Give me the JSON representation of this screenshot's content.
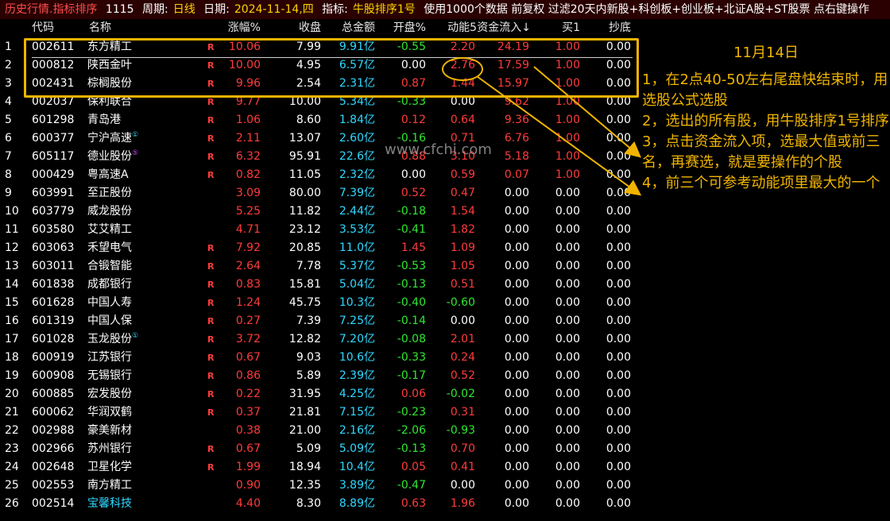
{
  "topbar": {
    "title": "历史行情.指标排序",
    "count": "1115",
    "period_label": "周期:",
    "period_value": "日线",
    "date_label": "日期:",
    "date_value": "2024-11-14,四",
    "indicator_label": "指标:",
    "indicator_value": "牛股排序1号",
    "extra": "使用1000个数据 前复权 过滤20天内新股+科创板+创业板+北证A股+ST股票 点右键操作"
  },
  "columns": {
    "code": "代码",
    "name": "名称",
    "change": "涨幅%",
    "close": "收盘",
    "amount": "总金额",
    "open": "开盘%",
    "momentum": "动能5",
    "inflow": "资金流入↓",
    "buy1": "买1",
    "bottom": "抄底"
  },
  "r_marker": "R",
  "rows": [
    {
      "idx": "1",
      "code": "002611",
      "name": "东方精工",
      "sup": "",
      "r": "R",
      "change": "10.06",
      "close": "7.99",
      "amount": "9.91亿",
      "open": "-0.55",
      "momentum": "2.20",
      "inflow": "24.19",
      "buy1": "1.00",
      "bottom": "0.00"
    },
    {
      "idx": "2",
      "code": "000812",
      "name": "陕西金叶",
      "sup": "",
      "r": "R",
      "change": "10.00",
      "close": "4.95",
      "amount": "6.57亿",
      "open": "0.00",
      "momentum": "2.76",
      "inflow": "17.59",
      "buy1": "1.00",
      "bottom": "0.00"
    },
    {
      "idx": "3",
      "code": "002431",
      "name": "棕榈股份",
      "sup": "",
      "r": "R",
      "change": "9.96",
      "close": "2.54",
      "amount": "2.31亿",
      "open": "0.87",
      "momentum": "1.44",
      "inflow": "15.97",
      "buy1": "1.00",
      "bottom": "0.00"
    },
    {
      "idx": "4",
      "code": "002037",
      "name": "保利联合",
      "sup": "",
      "r": "R",
      "change": "9.77",
      "close": "10.00",
      "amount": "5.34亿",
      "open": "-0.33",
      "momentum": "0.00",
      "inflow": "9.62",
      "buy1": "1.00",
      "bottom": "0.00"
    },
    {
      "idx": "5",
      "code": "601298",
      "name": "青岛港",
      "sup": "",
      "r": "R",
      "change": "1.06",
      "close": "8.60",
      "amount": "1.84亿",
      "open": "0.12",
      "momentum": "0.64",
      "inflow": "9.36",
      "buy1": "1.00",
      "bottom": "0.00"
    },
    {
      "idx": "6",
      "code": "600377",
      "name": "宁沪高速",
      "sup": "①",
      "r": "R",
      "change": "2.11",
      "close": "13.07",
      "amount": "2.60亿",
      "open": "-0.16",
      "momentum": "0.71",
      "inflow": "6.76",
      "buy1": "1.00",
      "bottom": "0.00"
    },
    {
      "idx": "7",
      "code": "605117",
      "name": "德业股份",
      "sup": "⑤",
      "r": "R",
      "change": "6.32",
      "close": "95.91",
      "amount": "22.6亿",
      "open": "0.88",
      "momentum": "3.10",
      "inflow": "5.18",
      "buy1": "1.00",
      "bottom": "0.00"
    },
    {
      "idx": "8",
      "code": "000429",
      "name": "粤高速A",
      "sup": "",
      "r": "R",
      "change": "0.82",
      "close": "11.05",
      "amount": "2.32亿",
      "open": "0.00",
      "momentum": "0.59",
      "inflow": "0.07",
      "buy1": "1.00",
      "bottom": "0.00"
    },
    {
      "idx": "9",
      "code": "603991",
      "name": "至正股份",
      "sup": "",
      "r": "",
      "change": "3.09",
      "close": "80.00",
      "amount": "7.39亿",
      "open": "0.52",
      "momentum": "0.47",
      "inflow": "0.00",
      "buy1": "0.00",
      "bottom": "0.00"
    },
    {
      "idx": "10",
      "code": "603779",
      "name": "威龙股份",
      "sup": "",
      "r": "",
      "change": "5.25",
      "close": "11.82",
      "amount": "2.44亿",
      "open": "-0.18",
      "momentum": "1.54",
      "inflow": "0.00",
      "buy1": "0.00",
      "bottom": "0.00"
    },
    {
      "idx": "11",
      "code": "603580",
      "name": "艾艾精工",
      "sup": "",
      "r": "",
      "change": "4.71",
      "close": "23.12",
      "amount": "3.53亿",
      "open": "-0.41",
      "momentum": "1.82",
      "inflow": "0.00",
      "buy1": "0.00",
      "bottom": "0.00"
    },
    {
      "idx": "12",
      "code": "603063",
      "name": "禾望电气",
      "sup": "",
      "r": "R",
      "change": "7.92",
      "close": "20.85",
      "amount": "11.0亿",
      "open": "1.45",
      "momentum": "1.09",
      "inflow": "0.00",
      "buy1": "0.00",
      "bottom": "0.00"
    },
    {
      "idx": "13",
      "code": "603011",
      "name": "合锻智能",
      "sup": "",
      "r": "R",
      "change": "2.64",
      "close": "7.78",
      "amount": "5.37亿",
      "open": "-0.53",
      "momentum": "1.05",
      "inflow": "0.00",
      "buy1": "0.00",
      "bottom": "0.00"
    },
    {
      "idx": "14",
      "code": "601838",
      "name": "成都银行",
      "sup": "",
      "r": "R",
      "change": "0.83",
      "close": "15.81",
      "amount": "5.04亿",
      "open": "-0.13",
      "momentum": "0.51",
      "inflow": "0.00",
      "buy1": "0.00",
      "bottom": "0.00"
    },
    {
      "idx": "15",
      "code": "601628",
      "name": "中国人寿",
      "sup": "",
      "r": "R",
      "change": "1.24",
      "close": "45.75",
      "amount": "10.3亿",
      "open": "-0.40",
      "momentum": "-0.60",
      "inflow": "0.00",
      "buy1": "0.00",
      "bottom": "0.00"
    },
    {
      "idx": "16",
      "code": "601319",
      "name": "中国人保",
      "sup": "",
      "r": "R",
      "change": "0.27",
      "close": "7.39",
      "amount": "7.25亿",
      "open": "-0.14",
      "momentum": "0.00",
      "inflow": "0.00",
      "buy1": "0.00",
      "bottom": "0.00"
    },
    {
      "idx": "17",
      "code": "601028",
      "name": "玉龙股份",
      "sup": "①",
      "r": "R",
      "change": "3.72",
      "close": "12.82",
      "amount": "7.20亿",
      "open": "-0.08",
      "momentum": "2.01",
      "inflow": "0.00",
      "buy1": "0.00",
      "bottom": "0.00"
    },
    {
      "idx": "18",
      "code": "600919",
      "name": "江苏银行",
      "sup": "",
      "r": "R",
      "change": "0.67",
      "close": "9.03",
      "amount": "10.6亿",
      "open": "-0.33",
      "momentum": "0.24",
      "inflow": "0.00",
      "buy1": "0.00",
      "bottom": "0.00"
    },
    {
      "idx": "19",
      "code": "600908",
      "name": "无锡银行",
      "sup": "",
      "r": "R",
      "change": "0.86",
      "close": "5.89",
      "amount": "2.39亿",
      "open": "-0.17",
      "momentum": "0.52",
      "inflow": "0.00",
      "buy1": "0.00",
      "bottom": "0.00"
    },
    {
      "idx": "20",
      "code": "600885",
      "name": "宏发股份",
      "sup": "",
      "r": "R",
      "change": "0.22",
      "close": "31.95",
      "amount": "4.25亿",
      "open": "0.06",
      "momentum": "-0.02",
      "inflow": "0.00",
      "buy1": "0.00",
      "bottom": "0.00"
    },
    {
      "idx": "21",
      "code": "600062",
      "name": "华润双鹤",
      "sup": "",
      "r": "R",
      "change": "0.37",
      "close": "21.81",
      "amount": "7.15亿",
      "open": "-0.23",
      "momentum": "0.31",
      "inflow": "0.00",
      "buy1": "0.00",
      "bottom": "0.00"
    },
    {
      "idx": "22",
      "code": "002988",
      "name": "豪美新材",
      "sup": "",
      "r": "",
      "change": "0.38",
      "close": "21.00",
      "amount": "2.16亿",
      "open": "-2.06",
      "momentum": "-0.93",
      "inflow": "0.00",
      "buy1": "0.00",
      "bottom": "0.00"
    },
    {
      "idx": "23",
      "code": "002966",
      "name": "苏州银行",
      "sup": "",
      "r": "R",
      "change": "0.67",
      "close": "5.09",
      "amount": "5.09亿",
      "open": "-0.13",
      "momentum": "0.70",
      "inflow": "0.00",
      "buy1": "0.00",
      "bottom": "0.00"
    },
    {
      "idx": "24",
      "code": "002648",
      "name": "卫星化学",
      "sup": "",
      "r": "R",
      "change": "1.99",
      "close": "18.94",
      "amount": "10.4亿",
      "open": "0.05",
      "momentum": "0.41",
      "inflow": "0.00",
      "buy1": "0.00",
      "bottom": "0.00"
    },
    {
      "idx": "25",
      "code": "002553",
      "name": "南方精工",
      "sup": "",
      "r": "",
      "change": "0.90",
      "close": "12.35",
      "amount": "3.89亿",
      "open": "-0.47",
      "momentum": "0.00",
      "inflow": "0.00",
      "buy1": "0.00",
      "bottom": "0.00"
    },
    {
      "idx": "26",
      "code": "002514",
      "name": "宝馨科技",
      "sup": "",
      "r": "",
      "change": "4.40",
      "close": "8.30",
      "amount": "8.89亿",
      "open": "0.63",
      "momentum": "1.96",
      "inflow": "0.00",
      "buy1": "0.00",
      "bottom": "0.00",
      "name_color": "#2fd8ff"
    }
  ],
  "watermark": "www.cfchi.com",
  "notes": {
    "date": "11月14日",
    "lines": [
      "1，在2点40-50左右尾盘快结束时，用选股公式选股",
      "2，选出的所有股，用牛股排序1号排序",
      "3，点击资金流入项，选最大值或前三名，再赛选，就是要操作的个股",
      "4，前三个可参考动能项里最大的一个"
    ]
  },
  "colors": {
    "up": "#ff3b3b",
    "down": "#2ee82e",
    "amount": "#2fd8ff",
    "annotation": "#f0b400",
    "background": "#000000"
  }
}
